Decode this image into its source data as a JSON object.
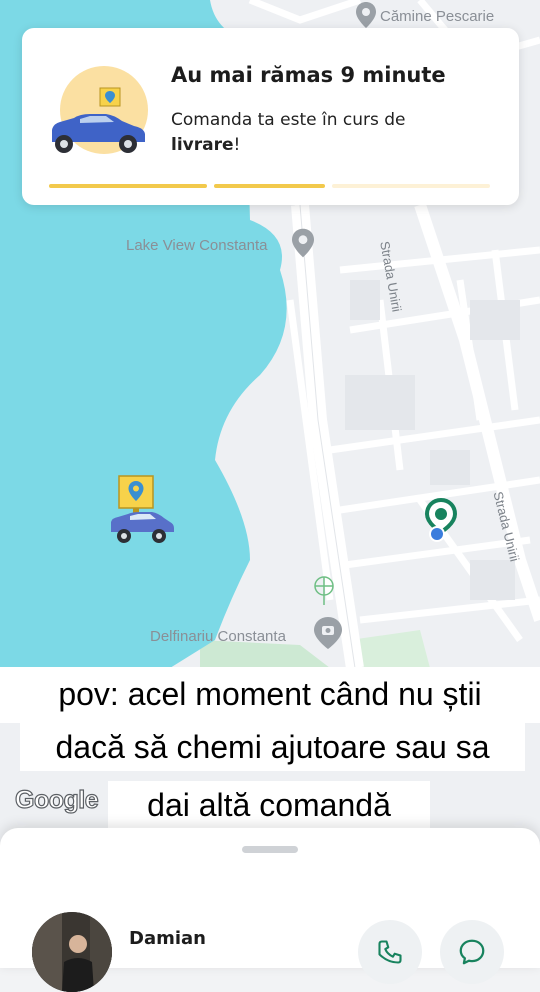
{
  "map": {
    "poi": {
      "camine": "Cămine Pescarie",
      "lake_view": "Lake View Constanta",
      "delfinariu": "Delfinariu Constanta"
    },
    "streets": {
      "unirii_top": "Strada Unirii",
      "unirii_right": "Strada Unirii"
    },
    "google_logo": "Google"
  },
  "status_card": {
    "title": "Au mai rămas 9 minute",
    "text_prefix": "Comanda ta este în curs de",
    "text_bold": "livrare",
    "text_suffix": "!",
    "progress_steps": [
      {
        "state": "done",
        "color": "#f2c94c"
      },
      {
        "state": "done",
        "color": "#f2c94c"
      },
      {
        "state": "pending",
        "color": "#fdf1d6"
      }
    ]
  },
  "caption": {
    "line1": "pov: acel moment când nu știi",
    "line2": "dacă să chemi ajutoare sau sa",
    "line3": "dai altă comandă"
  },
  "driver": {
    "name": "Damian",
    "call_icon": "phone-icon",
    "chat_icon": "chat-icon"
  },
  "colors": {
    "water": "#7cd9e6",
    "accent_yellow": "#f2c94c",
    "car_blue": "#3f63c7",
    "location_green": "#18835e",
    "park_green": "#cde9d3"
  }
}
